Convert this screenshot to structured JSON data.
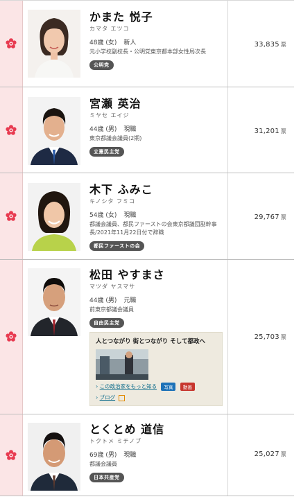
{
  "vote_unit": "票",
  "candidates": [
    {
      "name": "かまた 悦子",
      "kana": "カマタ エツコ",
      "age_sex": "48歳 (女)",
      "status": "新人",
      "career": "元小学校副校長・公明党東京都本部女性局次長",
      "party": "公明党",
      "votes": "33,835"
    },
    {
      "name": "宮瀬 英治",
      "kana": "ミヤセ エイジ",
      "age_sex": "44歳 (男)",
      "status": "現職",
      "career": "東京都議会議員(2期)",
      "party": "立憲民主党",
      "votes": "31,201"
    },
    {
      "name": "木下 ふみこ",
      "kana": "キノシタ フミコ",
      "age_sex": "54歳 (女)",
      "status": "現職",
      "career": "都議会議員、都民ファーストの会東京都議団副幹事長/2021年11月22日付で辞職",
      "party": "都民ファーストの会",
      "votes": "29,767"
    },
    {
      "name": "松田 やすまさ",
      "kana": "マツダ ヤスマサ",
      "age_sex": "44歳 (男)",
      "status": "元職",
      "career": "前東京都議会議員",
      "party": "自由民主党",
      "votes": "25,703",
      "promo": {
        "title": "人とつながり 街とつながり そして都政へ",
        "more_link": "この政治家をもっと知る",
        "tag_photo": "写真",
        "tag_video": "動画",
        "blog_link": "ブログ"
      }
    },
    {
      "name": "とくとめ 道信",
      "kana": "トクトメ ミチノブ",
      "age_sex": "69歳 (男)",
      "status": "現職",
      "career": "都議会議員",
      "party": "日本共産党",
      "votes": "25,027"
    }
  ]
}
